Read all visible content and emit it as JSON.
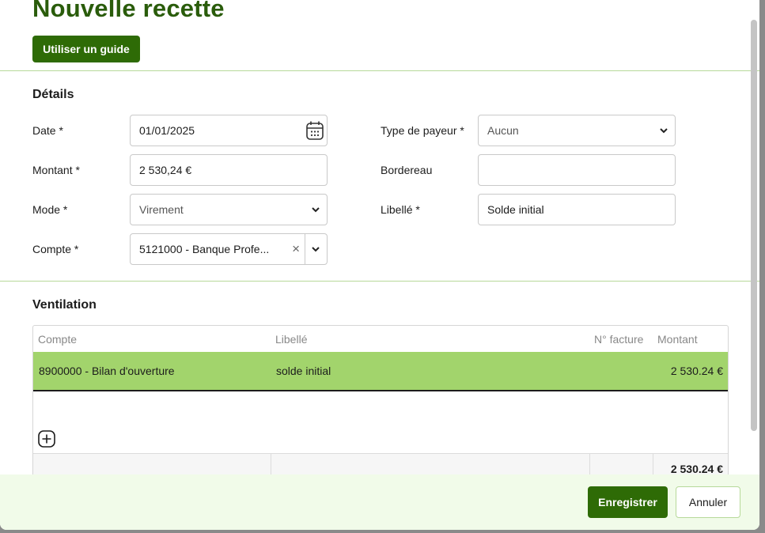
{
  "modal": {
    "title": "Nouvelle recette",
    "guide_button": "Utiliser un guide"
  },
  "details": {
    "section_title": "Détails",
    "date": {
      "label": "Date *",
      "value": "01/01/2025",
      "icon": "calendar-icon"
    },
    "montant": {
      "label": "Montant *",
      "value": "2 530,24 €"
    },
    "mode": {
      "label": "Mode *",
      "value": "Virement"
    },
    "compte": {
      "label": "Compte *",
      "value": "5121000 - Banque Profe...",
      "clear": "×"
    },
    "type_payeur": {
      "label": "Type de payeur *",
      "value": "Aucun"
    },
    "bordereau": {
      "label": "Bordereau",
      "value": ""
    },
    "libelle": {
      "label": "Libellé *",
      "value": "Solde initial"
    }
  },
  "ventilation": {
    "section_title": "Ventilation",
    "columns": [
      "Compte",
      "Libellé",
      "N° facture",
      "Montant"
    ],
    "rows": [
      {
        "compte": "8900000 - Bilan d'ouverture",
        "libelle": "solde initial",
        "facture": "",
        "montant": "2 530.24 €"
      }
    ],
    "total": "2 530.24 €"
  },
  "footer": {
    "save_label": "Enregistrer",
    "cancel_label": "Annuler"
  },
  "colors": {
    "brand": "#2e6b06",
    "title": "#2a5c0b",
    "row_highlight": "#a2d46c",
    "footer_bg": "#f1fbe9"
  }
}
